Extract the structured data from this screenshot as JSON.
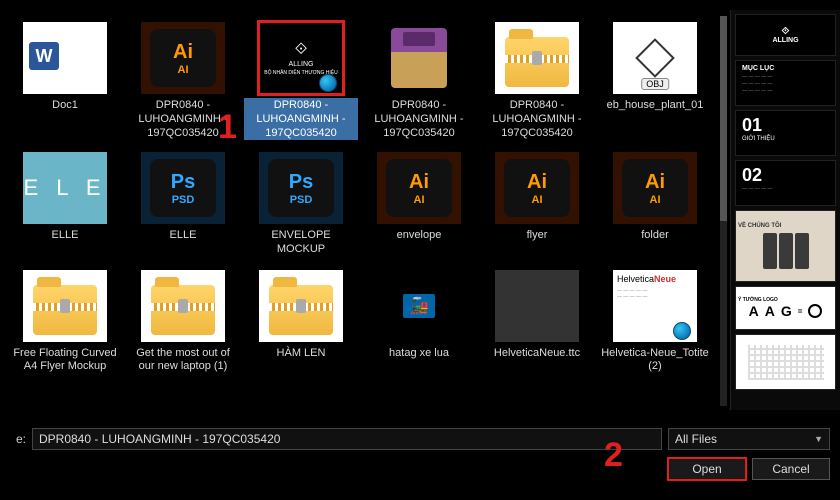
{
  "dialog": {
    "filename_label": "e:",
    "filename_value": "DPR0840 - LUHOANGMINH - 197QC035420",
    "filetype_selected": "All Files",
    "open_button": "Open",
    "cancel_button": "Cancel"
  },
  "annotations": {
    "marker1": "1",
    "marker2": "2"
  },
  "files": [
    {
      "label": "Doc1",
      "type": "word"
    },
    {
      "label": "DPR0840 - LUHOANGMINH - 197QC035420",
      "type": "ai"
    },
    {
      "label": "DPR0840 - LUHOANGMINH - 197QC035420",
      "type": "black-logo",
      "selected": true,
      "edge": true,
      "logo_mark": "⟐",
      "logo_text1": "ALLING",
      "logo_text2": "BỘ NHẬN DIỆN THƯƠNG HIỆU"
    },
    {
      "label": "DPR0840 - LUHOANGMINH - 197QC035420",
      "type": "rar"
    },
    {
      "label": "DPR0840 - LUHOANGMINH - 197QC035420",
      "type": "folder-zip"
    },
    {
      "label": "eb_house_plant_01",
      "type": "obj",
      "obj_text": "OBJ"
    },
    {
      "label": "ELLE",
      "type": "elle",
      "elle_text": "E L E"
    },
    {
      "label": "ELLE",
      "type": "psd"
    },
    {
      "label": "ENVELOPE MOCKUP",
      "type": "psd"
    },
    {
      "label": "envelope",
      "type": "ai"
    },
    {
      "label": "flyer",
      "type": "ai"
    },
    {
      "label": "folder",
      "type": "ai"
    },
    {
      "label": "Free Floating Curved A4 Flyer Mockup",
      "type": "folder-zip"
    },
    {
      "label": "Get the most out of our new laptop (1)",
      "type": "folder-zip"
    },
    {
      "label": "HÀM LEN",
      "type": "folder-zip"
    },
    {
      "label": "hatag xe lua",
      "type": "hatag"
    },
    {
      "label": "HelveticaNeue.ttc",
      "type": "helv-ttc"
    },
    {
      "label": "Helvetica-Neue_Totite (2)",
      "type": "helv-doc",
      "edge": true,
      "hv_black": "Helvetica",
      "hv_red": "Neue"
    }
  ],
  "ai_icon": {
    "top": "Ai",
    "bot": "AI"
  },
  "psd_icon": {
    "top": "Ps",
    "bot": "PSD"
  },
  "preview": {
    "logo": "⟐",
    "logo_sub": "ALLING",
    "muc_luc": "MỤC LỤC",
    "sec01": "01",
    "sec01_sub": "GIỚI THIỆU",
    "sec02": "02",
    "aag_label": "Ý TƯỞNG LOGO",
    "aag_a": "A",
    "aag_a2": "A",
    "aag_g": "G"
  }
}
